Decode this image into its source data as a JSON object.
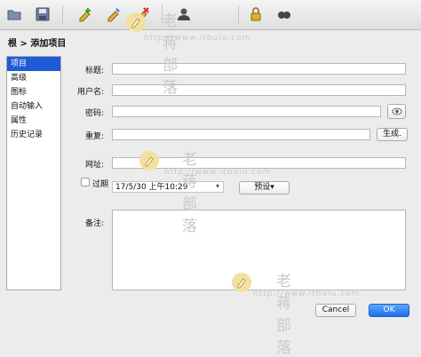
{
  "breadcrumb": "根 > 添加项目",
  "sidebar": {
    "items": [
      {
        "label": "项目",
        "active": true
      },
      {
        "label": "高级"
      },
      {
        "label": "图标"
      },
      {
        "label": "自动输入"
      },
      {
        "label": "属性"
      },
      {
        "label": "历史记录"
      }
    ]
  },
  "form": {
    "title_label": "标题:",
    "title_value": "",
    "username_label": "用户名:",
    "username_value": "",
    "password_label": "密码:",
    "password_value": "",
    "repeat_label": "重复:",
    "repeat_value": "",
    "generate_button": "生成.",
    "url_label": "网址:",
    "url_value": "",
    "expires_label": "过期",
    "expires_date": "17/5/30 上午10:29",
    "preset_button": "预设▾",
    "notes_label": "备注:",
    "notes_value": ""
  },
  "footer": {
    "cancel_label": "Cancel",
    "ok_label": "OK"
  },
  "watermark": {
    "title": "老蒋部落",
    "url": "http://www.itbulu.com"
  },
  "colors": {
    "selection": "#1f5bd8",
    "ok_button": "#1f6fe8"
  },
  "icons": [
    "folder-icon",
    "save-icon",
    "add-entry-icon",
    "edit-entry-icon",
    "delete-entry-icon",
    "user-icon",
    "lock-icon",
    "search-icon",
    "show-password-icon"
  ]
}
